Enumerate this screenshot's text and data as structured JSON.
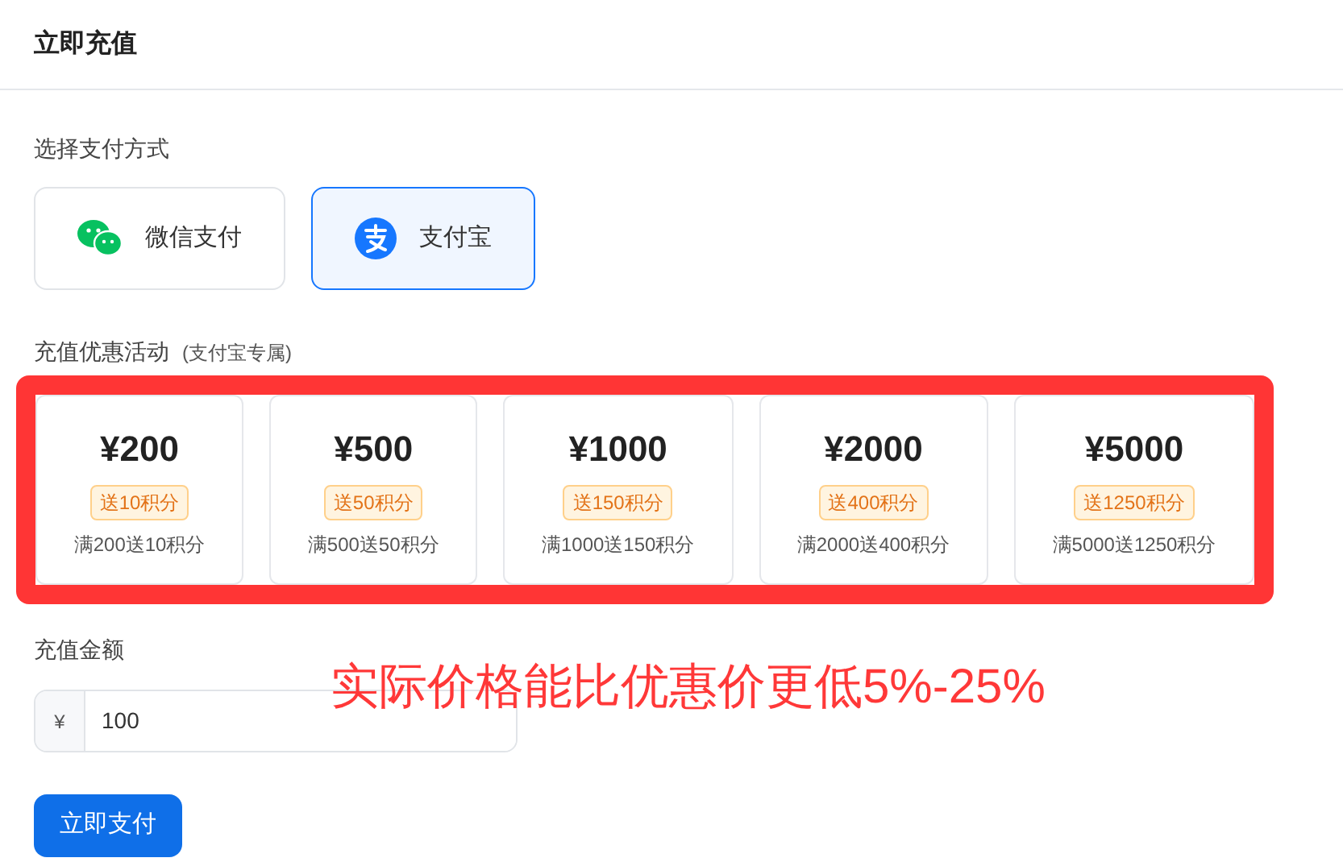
{
  "header": {
    "title": "立即充值"
  },
  "payment": {
    "label": "选择支付方式",
    "methods": [
      {
        "kind": "wechat",
        "label": "微信支付",
        "selected": false
      },
      {
        "kind": "alipay",
        "label": "支付宝",
        "selected": true
      }
    ]
  },
  "promotions": {
    "label": "充值优惠活动",
    "note": "(支付宝专属)",
    "highlighted": true,
    "items": [
      {
        "price": "¥200",
        "badge": "送10积分",
        "desc": "满200送10积分"
      },
      {
        "price": "¥500",
        "badge": "送50积分",
        "desc": "满500送50积分"
      },
      {
        "price": "¥1000",
        "badge": "送150积分",
        "desc": "满1000送150积分"
      },
      {
        "price": "¥2000",
        "badge": "送400积分",
        "desc": "满2000送400积分"
      },
      {
        "price": "¥5000",
        "badge": "送1250积分",
        "desc": "满5000送1250积分"
      }
    ]
  },
  "amount": {
    "label": "充值金额",
    "prefix": "¥",
    "value": "100"
  },
  "annotation": "实际价格能比优惠价更低5%-25%",
  "submit": "立即支付"
}
